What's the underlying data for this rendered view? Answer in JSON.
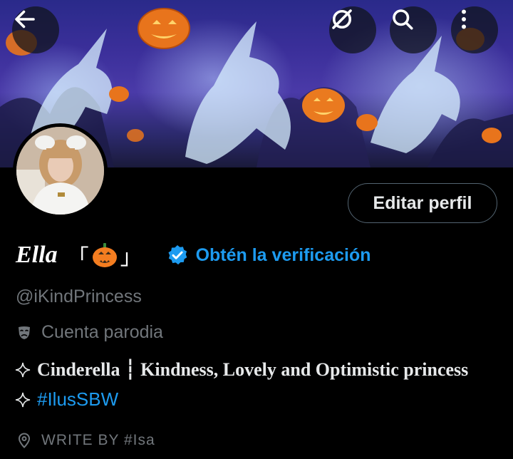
{
  "header": {
    "back_icon": "arrow-left-icon",
    "grok_icon": "circle-slash-icon",
    "search_icon": "search-icon",
    "more_icon": "more-vertical-icon"
  },
  "profile": {
    "display_name": "Ella",
    "bracket_open": "「",
    "bracket_close": "」",
    "name_emoji": "jack-o-lantern-icon",
    "verification_label": "Obtén la verificación",
    "handle": "@iKindPrincess",
    "parody_label": "Cuenta parodia",
    "edit_button": "Editar perfil",
    "bio_line1": "Cinderella ┆ Kindness, Lovely and Optimistic princess",
    "bio_hashtag": "#IlusSBW",
    "location": "WRITE BY #Isa"
  },
  "colors": {
    "accent": "#1d9bf0",
    "secondary_text": "#71767b",
    "background": "#000000"
  }
}
